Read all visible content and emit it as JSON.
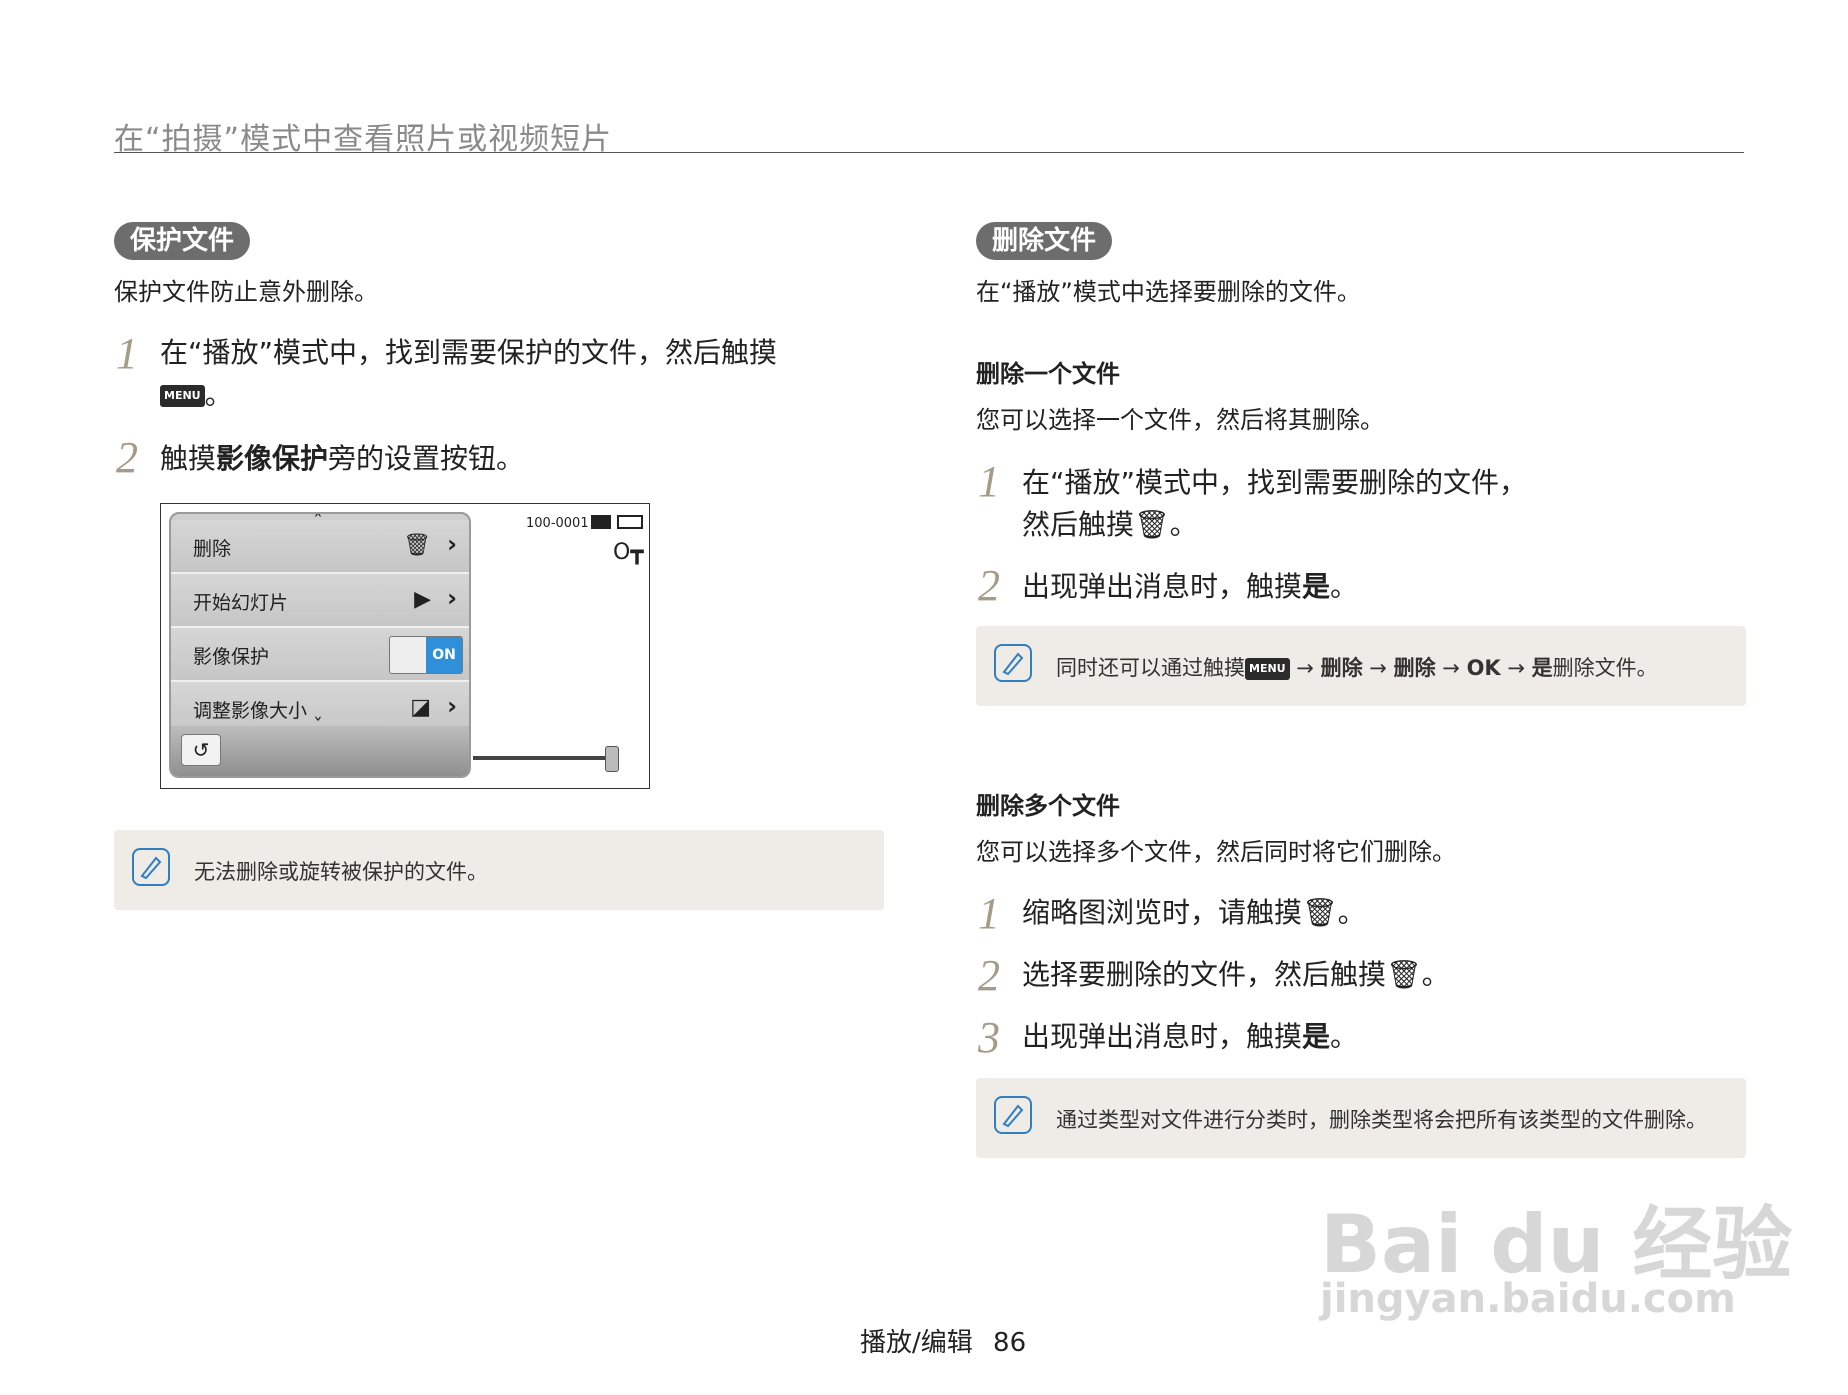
{
  "header": {
    "title": "在“拍摄”模式中查看照片或视频短片"
  },
  "left": {
    "section_pill": "保护文件",
    "intro": "保护文件防止意外删除。",
    "steps": [
      {
        "num": "1",
        "text_a": "在“播放”模式中，找到需要保护的文件，然后触摸",
        "menu_chip": "MENU",
        "text_b": "。"
      },
      {
        "num": "2",
        "text_a": "触摸",
        "bold": "影像保护",
        "text_b": "旁的设置按钮。"
      }
    ],
    "screen": {
      "file_number": "100-0001",
      "rows": [
        {
          "label": "删除",
          "icon": "trash-icon",
          "glyph": "🗑"
        },
        {
          "label": "开始幻灯片",
          "icon": "slideshow-icon",
          "glyph": "▶"
        },
        {
          "label": "影像保护",
          "toggle": "ON"
        },
        {
          "label": "调整影像大小",
          "icon": "resize-icon",
          "glyph": "◪"
        }
      ],
      "chevron": "›",
      "scroll_up": "ˆ",
      "scroll_down": "ˇ",
      "back_glyph": "↺",
      "key_glyph": "O┳"
    },
    "note": "无法删除或旋转被保护的文件。"
  },
  "right": {
    "section_pill": "删除文件",
    "intro": "在“播放”模式中选择要删除的文件。",
    "single": {
      "heading": "删除一个文件",
      "intro": "您可以选择一个文件，然后将其删除。",
      "steps": [
        {
          "num": "1",
          "line1": "在“播放”模式中，找到需要删除的文件，",
          "line2": "然后触摸",
          "glyph": "🗑",
          "end": "。"
        },
        {
          "num": "2",
          "text_a": "出现弹出消息时，触摸",
          "bold": "是",
          "text_b": "。"
        }
      ],
      "note": {
        "prefix": "同时还可以通过触摸",
        "menu_chip": "MENU",
        "arrow1": "→",
        "b1": "删除",
        "arrow2": "→",
        "b2": "删除",
        "arrow3": "→",
        "b3": "OK",
        "arrow4": "→",
        "b4": "是",
        "suffix": "删除文件。"
      }
    },
    "multi": {
      "heading": "删除多个文件",
      "intro": "您可以选择多个文件，然后同时将它们删除。",
      "steps": [
        {
          "num": "1",
          "text_a": "缩略图浏览时，请触摸",
          "glyph": "🗑",
          "text_b": "。"
        },
        {
          "num": "2",
          "text_a": "选择要删除的文件，然后触摸",
          "glyph": "🗑",
          "text_b": "。"
        },
        {
          "num": "3",
          "text_a": "出现弹出消息时，触摸",
          "bold": "是",
          "text_b": "。"
        }
      ],
      "note": "通过类型对文件进行分类时，删除类型将会把所有该类型的文件删除。"
    }
  },
  "footer": {
    "section": "播放/编辑",
    "page": "86"
  },
  "watermark": {
    "brand": "Bai du 经验",
    "url": "jingyan.baidu.com"
  }
}
